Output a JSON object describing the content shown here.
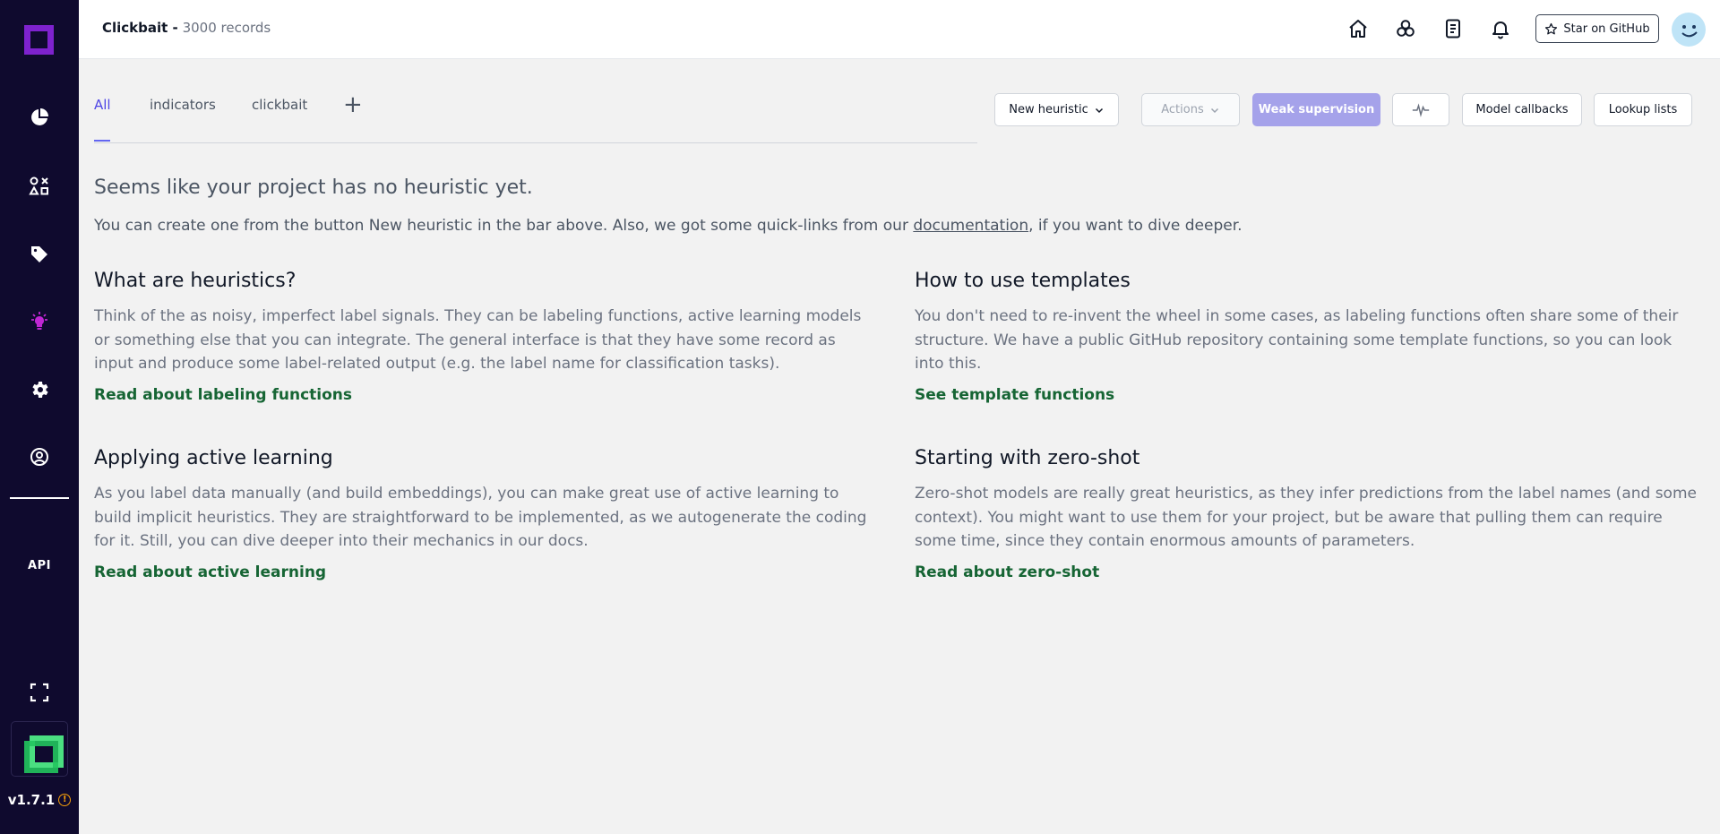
{
  "sidebar": {
    "items": [
      {
        "icon": "overview-pie-icon"
      },
      {
        "icon": "data-browser-icon"
      },
      {
        "icon": "labeling-tag-icon"
      },
      {
        "icon": "heuristics-bulb-icon",
        "active": true
      },
      {
        "icon": "settings-gear-icon"
      },
      {
        "icon": "account-user-icon"
      }
    ],
    "api_label": "API",
    "version": "v1.7.1",
    "active_color": "#c026d3"
  },
  "header": {
    "project_name": "Clickbait -",
    "record_count": "3000 records",
    "github_label": "Star on GitHub"
  },
  "tabs": [
    {
      "label": "All",
      "active": true
    },
    {
      "label": "indicators"
    },
    {
      "label": "clickbait"
    }
  ],
  "toolbar": {
    "new_heuristic": "New heuristic",
    "actions": "Actions",
    "weak_supervision": "Weak supervision",
    "model_callbacks": "Model callbacks",
    "lookup_lists": "Lookup lists"
  },
  "intro": {
    "heading": "Seems like your project has no heuristic yet.",
    "text_before": "You can create one from the button New heuristic in the bar above. Also, we got some quick-links from our ",
    "link": "documentation",
    "text_after": ", if you want to dive deeper."
  },
  "cards": [
    {
      "title": "What are heuristics?",
      "body": "Think of the as noisy, imperfect label signals. They can be labeling functions, active learning models or something else that you can integrate. The general interface is that they have some record as input and produce some label-related output (e.g. the label name for classification tasks).",
      "link": "Read about labeling functions"
    },
    {
      "title": "How to use templates",
      "body": "You don't need to re-invent the wheel in some cases, as labeling functions often share some of their structure. We have a public GitHub repository containing some template functions, so you can look into this.",
      "link": "See template functions"
    },
    {
      "title": "Applying active learning",
      "body": "As you label data manually (and build embeddings), you can make great use of active learning to build implicit heuristics. They are straightforward to be implemented, as we autogenerate the coding for it. Still, you can dive deeper into their mechanics in our docs.",
      "link": "Read about active learning"
    },
    {
      "title": "Starting with zero-shot",
      "body": "Zero-shot models are really great heuristics, as they infer predictions from the label names (and some context). You might want to use them for your project, but be aware that pulling them can require some time, since they contain enormous amounts of parameters.",
      "link": "Read about zero-shot"
    }
  ]
}
